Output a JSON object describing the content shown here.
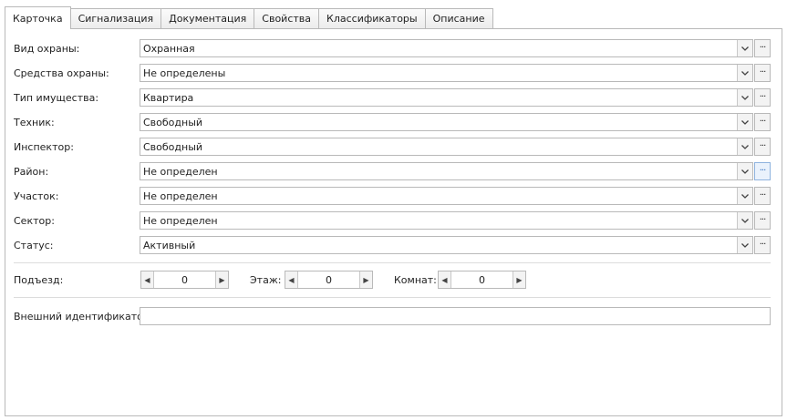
{
  "tabs": [
    {
      "label": "Карточка",
      "active": true
    },
    {
      "label": "Сигнализация",
      "active": false
    },
    {
      "label": "Документация",
      "active": false
    },
    {
      "label": "Свойства",
      "active": false
    },
    {
      "label": "Классификаторы",
      "active": false
    },
    {
      "label": "Описание",
      "active": false
    }
  ],
  "fields": [
    {
      "label": "Вид охраны:",
      "value": "Охранная"
    },
    {
      "label": "Средства охраны:",
      "value": "Не определены"
    },
    {
      "label": "Тип имущества:",
      "value": "Квартира"
    },
    {
      "label": "Техник:",
      "value": "Свободный"
    },
    {
      "label": "Инспектор:",
      "value": "Свободный"
    },
    {
      "label": "Район:",
      "value": "Не определен"
    },
    {
      "label": "Участок:",
      "value": "Не определен"
    },
    {
      "label": "Сектор:",
      "value": "Не определен"
    },
    {
      "label": "Статус:",
      "value": "Активный"
    }
  ],
  "icons": {
    "dropdown": "chevron-down-icon",
    "ellipsis": "ellipsis-icon",
    "spin_left": "arrow-left-icon",
    "spin_right": "arrow-right-icon"
  },
  "ellipsis_text": "···",
  "spinners": [
    {
      "label": "Подъезд:",
      "value": "0"
    },
    {
      "label": "Этаж:",
      "value": "0"
    },
    {
      "label": "Комнат:",
      "value": "0"
    }
  ],
  "external_id": {
    "label": "Внешний идентификатор:",
    "value": ""
  }
}
